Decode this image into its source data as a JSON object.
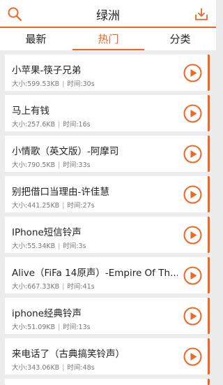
{
  "header": {
    "title": "绿洲",
    "search_icon": "search-icon",
    "download_icon": "download-icon",
    "accent": "#f26522"
  },
  "tabs": [
    {
      "label": "最新",
      "active": false
    },
    {
      "label": "热门",
      "active": true
    },
    {
      "label": "分类",
      "active": false
    }
  ],
  "ringtones": [
    {
      "name": "小苹果-筷子兄弟",
      "size_label": "大小:599.53KB",
      "sep": "|",
      "time_label": "时间:30s"
    },
    {
      "name": "马上有钱",
      "size_label": "大小:257.6KB",
      "sep": "|",
      "time_label": "时间:16s"
    },
    {
      "name": "小情歌（英文版）-阿摩司",
      "size_label": "大小:790.5KB",
      "sep": "|",
      "time_label": "时间:33s"
    },
    {
      "name": "别把借口当理由-许佳慧",
      "size_label": "大小:441.25KB",
      "sep": "|",
      "time_label": "时间:27s"
    },
    {
      "name": "IPhone短信铃声",
      "size_label": "大小:55.34KB",
      "sep": "|",
      "time_label": "时间:3s"
    },
    {
      "name": "Alive（FiFa 14原声）-Empire Of Th...",
      "size_label": "大小:667.33KB",
      "sep": "|",
      "time_label": "时间:41s"
    },
    {
      "name": "iphone经典铃声",
      "size_label": "大小:51.09KB",
      "sep": "|",
      "time_label": "时间:13s"
    },
    {
      "name": "来电话了（古典搞笑铃声）",
      "size_label": "大小:343.06KB",
      "sep": "|",
      "time_label": "时间:48s"
    }
  ]
}
